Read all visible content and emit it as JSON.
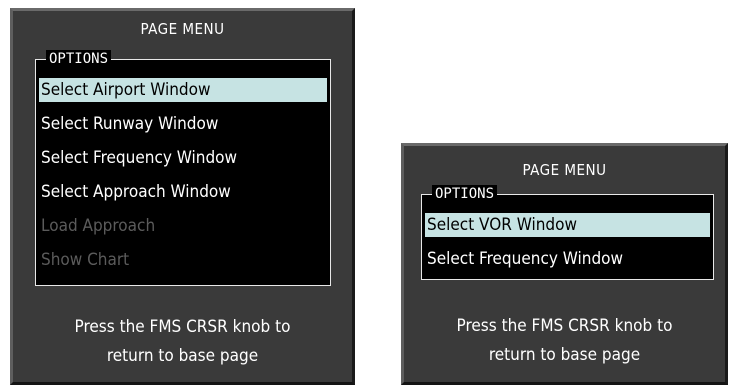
{
  "left_menu": {
    "title": "PAGE MENU",
    "options_label": "OPTIONS",
    "items": [
      {
        "label": "Select Airport Window"
      },
      {
        "label": "Select Runway Window"
      },
      {
        "label": "Select Frequency Window"
      },
      {
        "label": "Select Approach Window"
      },
      {
        "label": "Load Approach"
      },
      {
        "label": "Show Chart"
      }
    ],
    "footer_line1": "Press the FMS CRSR knob to",
    "footer_line2": "return to base page"
  },
  "right_menu": {
    "title": "PAGE MENU",
    "options_label": "OPTIONS",
    "items": [
      {
        "label": "Select VOR Window"
      },
      {
        "label": "Select Frequency Window"
      }
    ],
    "footer_line1": "Press the FMS CRSR knob to",
    "footer_line2": "return to base page"
  },
  "colors": {
    "panel_bg": "#3a3a3a",
    "options_bg": "#000000",
    "highlight": "#c6e3e3",
    "disabled_text": "#5b5b5b",
    "text": "#ffffff"
  }
}
